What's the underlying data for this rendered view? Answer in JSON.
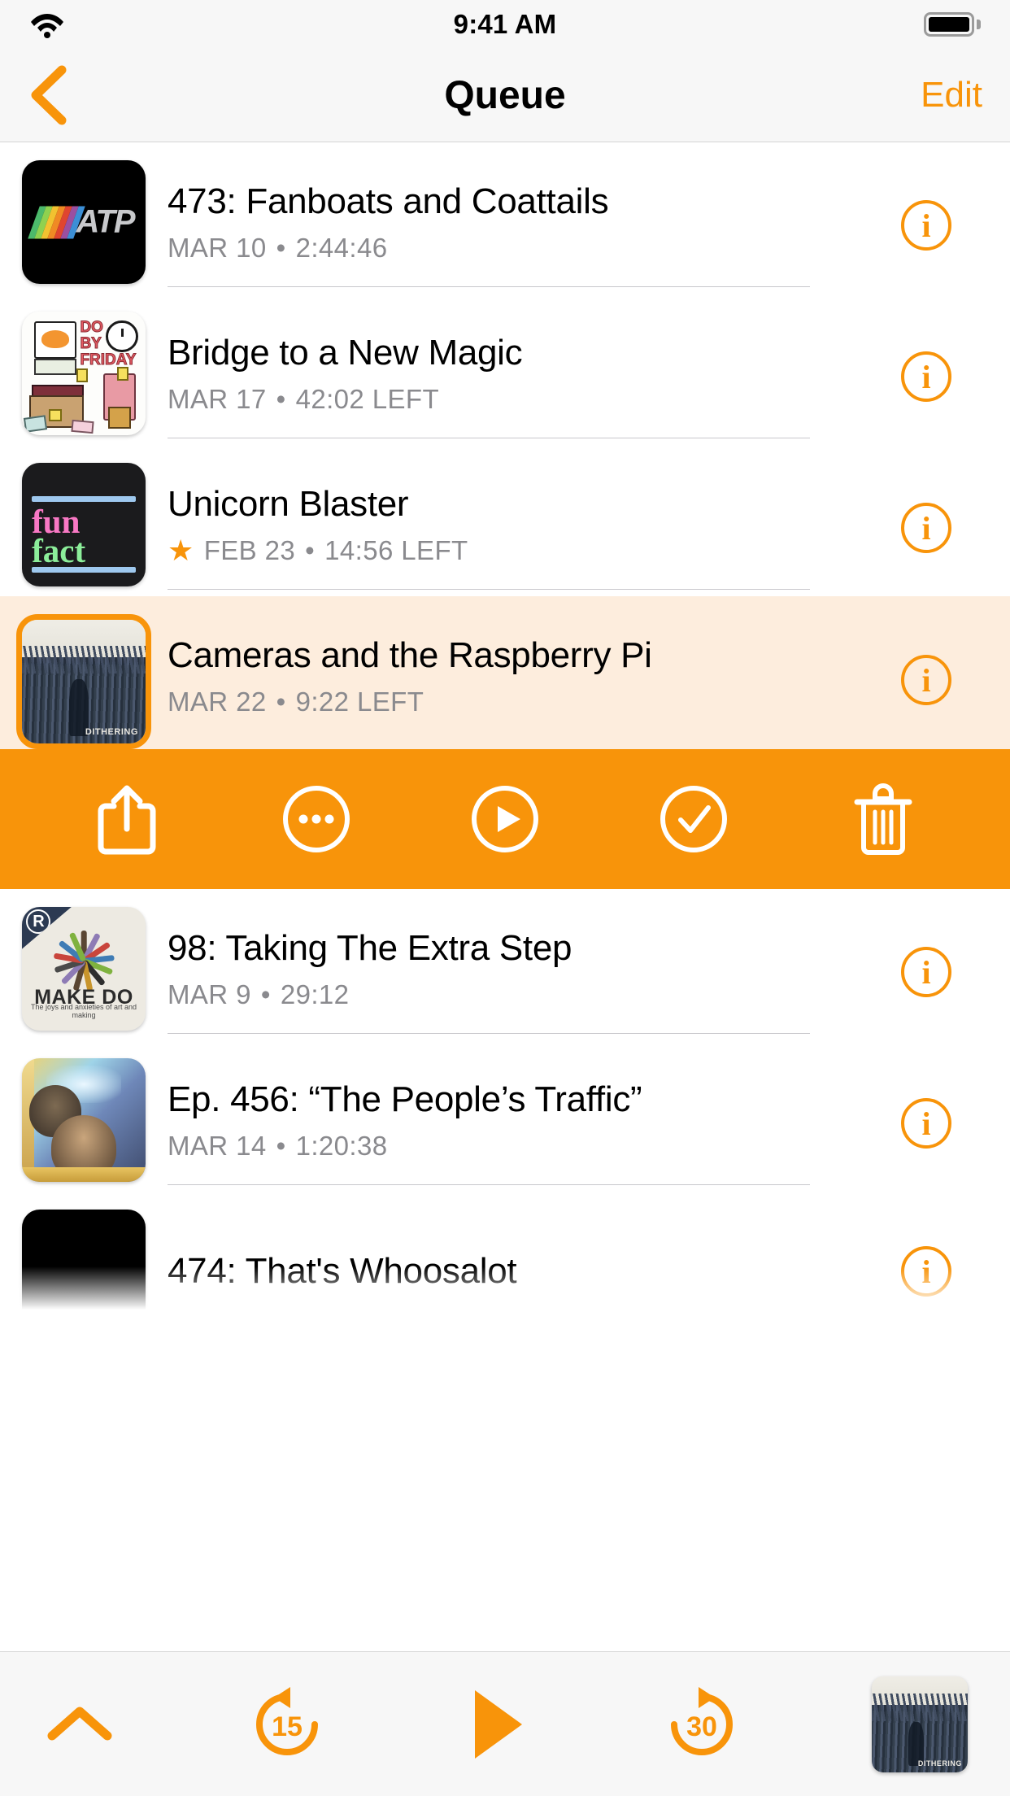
{
  "status_bar": {
    "time": "9:41 AM",
    "wifi_icon": "wifi-icon",
    "battery_icon": "battery-full-icon"
  },
  "nav_bar": {
    "back_icon": "chevron-left-icon",
    "title": "Queue",
    "edit_label": "Edit"
  },
  "theme": {
    "accent": "#F8940A",
    "selected_row_bg": "#FDEDDD",
    "meta_text": "#8A8A8E",
    "separator": "#C8C7CC",
    "chrome_bg": "#F7F7F7"
  },
  "episodes": [
    {
      "title": "473: Fanboats and Coattails",
      "date": "MAR 10",
      "duration": "2:44:46",
      "starred": false,
      "selected": false,
      "artwork": "atp",
      "info_label": "i"
    },
    {
      "title": "Bridge to a New Magic",
      "date": "MAR 17",
      "duration": "42:02 LEFT",
      "starred": false,
      "selected": false,
      "artwork": "do-by-friday",
      "info_label": "i"
    },
    {
      "title": "Unicorn Blaster",
      "date": "FEB 23",
      "duration": "14:56 LEFT",
      "starred": true,
      "star_icon": "star-icon",
      "selected": false,
      "artwork": "fun-fact",
      "info_label": "i"
    },
    {
      "title": "Cameras and the Raspberry Pi",
      "date": "MAR 22",
      "duration": "9:22 LEFT",
      "starred": false,
      "selected": true,
      "artwork": "dithering",
      "info_label": "i"
    },
    {
      "title": "98: Taking The Extra Step",
      "date": "MAR 9",
      "duration": "29:12",
      "starred": false,
      "selected": false,
      "artwork": "make-do",
      "info_label": "i"
    },
    {
      "title": "Ep. 456: “The People’s Traffic”",
      "date": "MAR 14",
      "duration": "1:20:38",
      "starred": false,
      "selected": false,
      "artwork": "peoples-traffic",
      "info_label": "i"
    },
    {
      "title": "474: That's Whoosalot",
      "date": "",
      "duration": "",
      "starred": false,
      "selected": false,
      "artwork": "black",
      "info_label": "i"
    }
  ],
  "meta_separator": "•",
  "action_bar": {
    "buttons": [
      {
        "name": "share-button",
        "icon": "share-icon"
      },
      {
        "name": "more-button",
        "icon": "ellipsis-circle-icon"
      },
      {
        "name": "play-button",
        "icon": "play-circle-icon"
      },
      {
        "name": "mark-played-button",
        "icon": "check-circle-icon"
      },
      {
        "name": "delete-button",
        "icon": "trash-icon"
      }
    ]
  },
  "player_bar": {
    "expand_icon": "chevron-up-icon",
    "skip_back_label": "15",
    "skip_forward_label": "30",
    "play_icon": "play-icon",
    "now_playing_artwork": "dithering",
    "now_playing_art_label": "DITHERING"
  },
  "artwork_text": {
    "atp": "ATP",
    "do_by_friday_do": "DO",
    "do_by_friday_by": "BY",
    "do_by_friday_friday": "FRIDAY",
    "fun_fact_line1": "fun",
    "fun_fact_line2": "fact",
    "dithering_label": "DITHERING",
    "make_do_title": "MAKE DO",
    "make_do_sub": "The joys and anxieties of art and making"
  }
}
